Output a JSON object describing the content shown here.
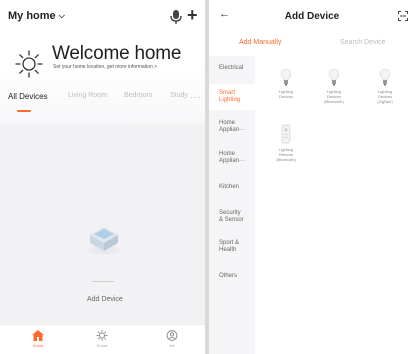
{
  "home_screen": {
    "home_selector": "My home",
    "welcome_title": "Welcome home",
    "welcome_subtitle": "Set your home location, get more information >",
    "tabs": [
      {
        "label": "All Devices",
        "active": true
      },
      {
        "label": "Living Room",
        "active": false
      },
      {
        "label": "Bedroom",
        "active": false
      },
      {
        "label": "Study",
        "active": false
      }
    ],
    "more_label": "···",
    "empty_action_label": "Add Device",
    "bottom_nav": [
      {
        "label": "Home",
        "icon": "home-icon",
        "active": true
      },
      {
        "label": "Smart",
        "icon": "smart-icon",
        "active": false
      },
      {
        "label": "Me",
        "icon": "profile-icon",
        "active": false
      }
    ]
  },
  "add_device_screen": {
    "title": "Add Device",
    "tabs": [
      {
        "label": "Add Manually",
        "active": true
      },
      {
        "label": "Search Device",
        "active": false
      }
    ],
    "categories": [
      {
        "label": "Electrical",
        "active": false
      },
      {
        "label": "Smart\nLighting",
        "active": true
      },
      {
        "label": "Home\nApplian···",
        "active": false
      },
      {
        "label": "Home\nApplian···",
        "active": false
      },
      {
        "label": "Kitchen",
        "active": false
      },
      {
        "label": "Security\n& Sensor",
        "active": false
      },
      {
        "label": "Sport &\nHealth",
        "active": false
      },
      {
        "label": "Others",
        "active": false
      }
    ],
    "devices": [
      {
        "label": "Lighting\nDevices"
      },
      {
        "label": "Lighting\nDevices\n(Bluetooth)"
      },
      {
        "label": "Lighting\nDevices\n(ZigBee)"
      },
      {
        "label": "Lighting\nRemote\n(Bluetooth)"
      }
    ]
  },
  "colors": {
    "accent": "#ff6a2c",
    "text_primary": "#222222",
    "text_muted": "#bbbbbb",
    "sidebar_bg": "#f5f5f7"
  }
}
